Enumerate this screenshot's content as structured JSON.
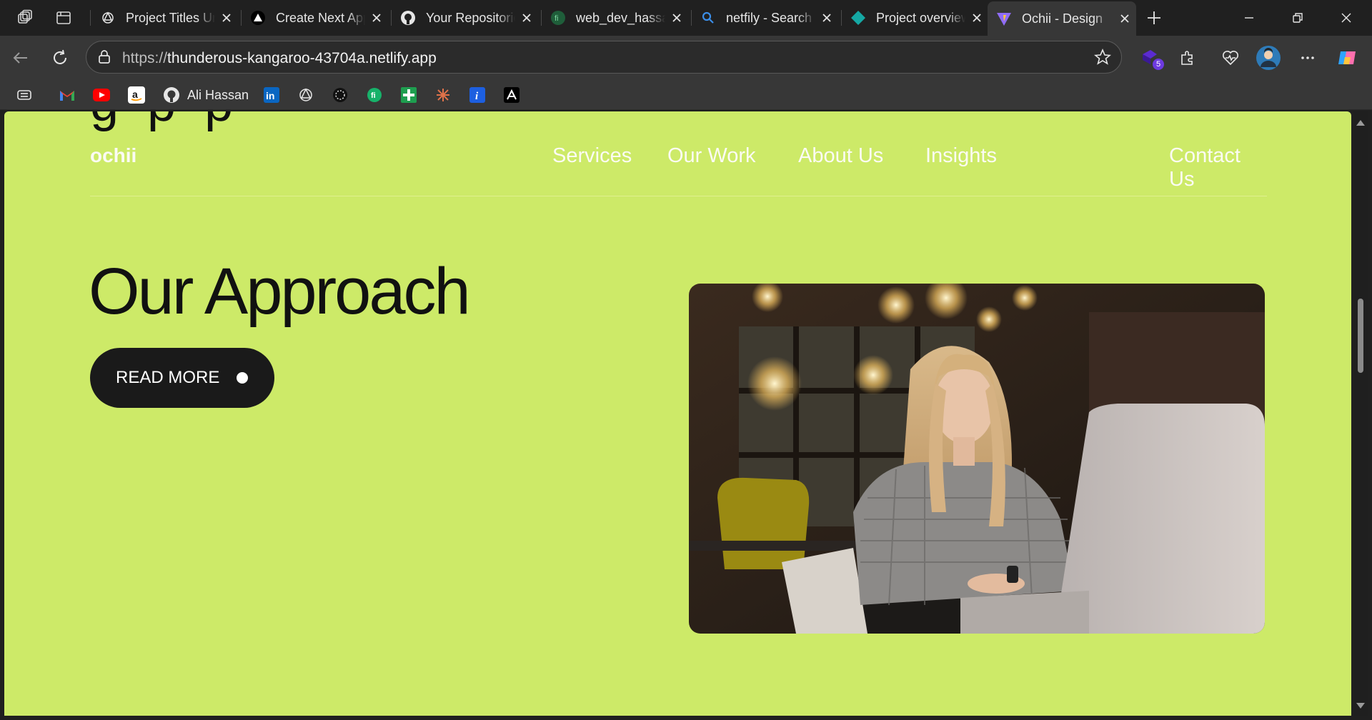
{
  "browser": {
    "tabs": [
      {
        "title": "Project Titles Ur",
        "icon": "openai-icon"
      },
      {
        "title": "Create Next App",
        "icon": "triangle-icon"
      },
      {
        "title": "Your Repositories",
        "icon": "github-icon"
      },
      {
        "title": "web_dev_hassan",
        "icon": "fi-icon"
      },
      {
        "title": "netfily - Search",
        "icon": "search-icon"
      },
      {
        "title": "Project overview",
        "icon": "netlify-icon"
      },
      {
        "title": "Ochii - Design",
        "icon": "vite-icon",
        "active": true
      }
    ],
    "url_protocol": "https://",
    "url_host": "thunderous-kangaroo-43704a.netlify.app",
    "extensions_badge": "5",
    "bookmarks": [
      {
        "icon": "reader-icon",
        "label": ""
      },
      {
        "icon": "gmail-icon",
        "label": ""
      },
      {
        "icon": "youtube-icon",
        "label": ""
      },
      {
        "icon": "amazon-icon",
        "label": ""
      },
      {
        "icon": "github-icon",
        "label": "Ali Hassan"
      },
      {
        "icon": "linkedin-icon",
        "label": ""
      },
      {
        "icon": "openai-icon",
        "label": ""
      },
      {
        "icon": "perplexity-icon",
        "label": ""
      },
      {
        "icon": "fi-icon",
        "label": ""
      },
      {
        "icon": "sheets-plus-icon",
        "label": ""
      },
      {
        "icon": "claude-icon",
        "label": ""
      },
      {
        "icon": "info-icon",
        "label": ""
      },
      {
        "icon": "arc-icon",
        "label": ""
      }
    ]
  },
  "page": {
    "background": "#cdea68",
    "logo": "ochii",
    "nav": [
      "Services",
      "Our Work",
      "About Us",
      "Insights",
      "Contact Us"
    ],
    "heading": "Our Approach",
    "cta_label": "READ MORE",
    "image": "woman-with-laptop-photo"
  }
}
